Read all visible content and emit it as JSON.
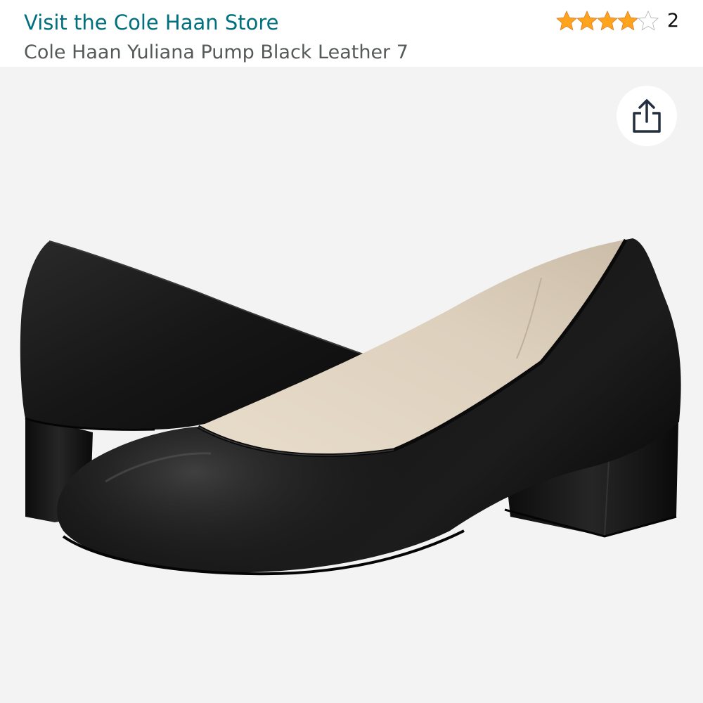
{
  "header": {
    "store_link": "Visit the Cole Haan Store",
    "product_title": "Cole Haan Yuliana Pump Black Leather 7"
  },
  "rating": {
    "stars": 4.5,
    "max_stars": 5,
    "count": "2",
    "star_color": "#ffa41c"
  },
  "image": {
    "subject": "black leather low block heel pump, pair",
    "background_color": "#f3f3f3"
  },
  "share": {
    "icon": "share-icon"
  }
}
